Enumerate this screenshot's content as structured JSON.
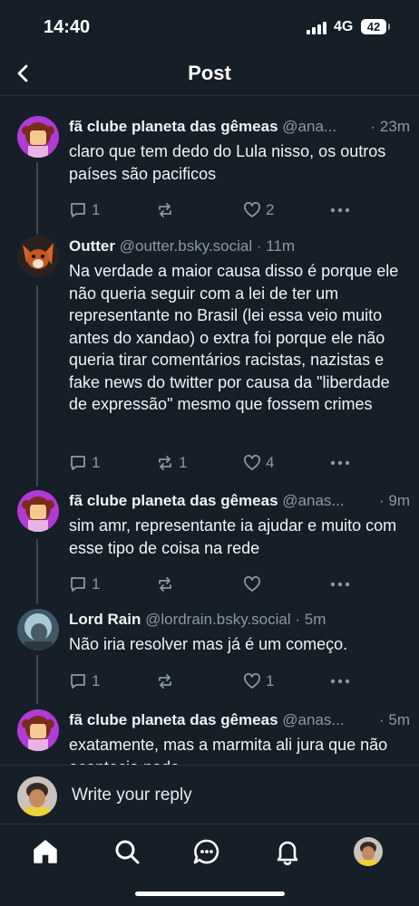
{
  "status_bar": {
    "time": "14:40",
    "network": "4G",
    "battery": "42"
  },
  "header": {
    "title": "Post"
  },
  "posts": [
    {
      "author": "fã clube planeta das gêmeas",
      "handle": "@ana...",
      "age": "· 23m",
      "text": "claro que tem dedo do Lula nisso, os outros países são pacificos",
      "replies": "1",
      "reposts": "",
      "likes": "2"
    },
    {
      "author": "Outter",
      "handle": "@outter.bsky.social",
      "age": "· 11m",
      "text": "Na verdade a maior causa disso é porque ele não queria seguir com a lei de ter um representante no Brasil (lei essa veio muito antes do xandao) o extra foi porque ele não queria tirar comentários racistas, nazistas e fake news do twitter por causa da \"liberdade de expressão\" mesmo que fossem crimes",
      "replies": "1",
      "reposts": "1",
      "likes": "4"
    },
    {
      "author": "fã clube planeta das gêmeas",
      "handle": "@anas...",
      "age": "· 9m",
      "text": "sim amr, representante ia ajudar e muito com esse tipo de coisa na rede",
      "replies": "1",
      "reposts": "",
      "likes": ""
    },
    {
      "author": "Lord Rain",
      "handle": "@lordrain.bsky.social",
      "age": "· 5m",
      "text": "Não iria resolver mas já é um começo.",
      "replies": "1",
      "reposts": "",
      "likes": "1"
    },
    {
      "author": "fã clube planeta das gêmeas",
      "handle": "@anas...",
      "age": "· 5m",
      "text": "exatamente, mas a marmita ali jura que não acontecia nada",
      "replies": "",
      "reposts": "",
      "likes": ""
    }
  ],
  "reply_bar": {
    "placeholder": "Write your reply"
  },
  "tabs": [
    "home-icon",
    "search-icon",
    "chat-icon",
    "notifications-icon",
    "profile-avatar"
  ],
  "colors": {
    "background": "#161e27",
    "muted": "#8b98a5",
    "thread_line": "#3b4754"
  }
}
